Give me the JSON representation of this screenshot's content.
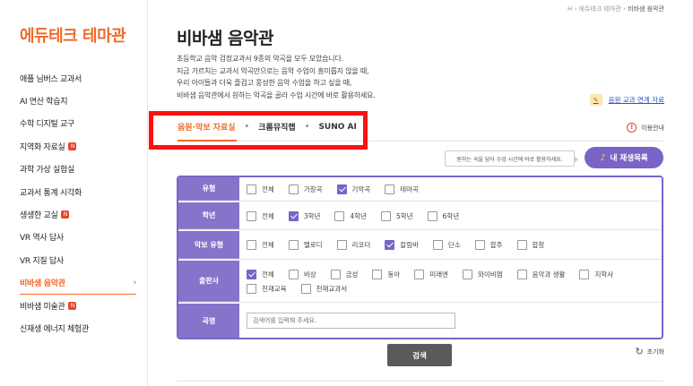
{
  "sidebar": {
    "brand": "에듀테크 테마관",
    "items": [
      {
        "label": "애플 님버스 교과서",
        "new": false
      },
      {
        "label": "AI 연산 학습지",
        "new": false
      },
      {
        "label": "수학 디지털 교구",
        "new": false
      },
      {
        "label": "지역화 자료실",
        "new": true
      },
      {
        "label": "과학 가상 실험실",
        "new": false
      },
      {
        "label": "교과서 통계 시각화",
        "new": false
      },
      {
        "label": "생생한 교실",
        "new": true
      },
      {
        "label": "VR 역사 답사",
        "new": false
      },
      {
        "label": "VR 지질 답사",
        "new": false
      },
      {
        "label": "비바샘 음악관",
        "new": false,
        "active": true
      },
      {
        "label": "비바샘 미술관",
        "new": true
      },
      {
        "label": "신재생 에너지 체험관",
        "new": false
      }
    ],
    "new_badge": "N",
    "active_chevron": "›"
  },
  "breadcrumb": {
    "home": "H",
    "sep1": "›",
    "parent": "에듀테크 테마관",
    "sep2": "›",
    "current": "비바샘 음악관"
  },
  "header": {
    "title": "비바샘 음악관",
    "intro_lines": [
      "초등학교 음악 검정교과서 9종의 악곡을 모두 모았습니다.",
      "지금 가르치는 교과서 악곡만으로는 음악 수업이 흥미롭지 않을 때,",
      "우리 아이들과 더욱 즐겁고 풍성한 음악 수업을 하고 싶을 때,",
      "비바샘 음악관에서 원하는 악곡을 골라 수업 시간에 바로 활용하세요."
    ],
    "linked_label": "음원 교과 연계 자료"
  },
  "tabs": [
    {
      "label": "음원·악보 자료실",
      "active": true
    },
    {
      "label": "크롬뮤직랩",
      "active": false
    },
    {
      "label": "SUNO AI",
      "active": false
    }
  ],
  "tab_sep": "•",
  "usage_label": "이용안내",
  "usage_icon": "!",
  "tip": "원하는 곡을 담아 수업 시간에 바로 활용하세요.",
  "my_list": "내 재생목록",
  "filters": {
    "type": {
      "label": "유형",
      "options": [
        {
          "t": "전체",
          "on": false
        },
        {
          "t": "가창곡",
          "on": false
        },
        {
          "t": "기악곡",
          "on": true
        },
        {
          "t": "테마곡",
          "on": false
        }
      ]
    },
    "grade": {
      "label": "학년",
      "options": [
        {
          "t": "전체",
          "on": false
        },
        {
          "t": "3학년",
          "on": true
        },
        {
          "t": "4학년",
          "on": false
        },
        {
          "t": "5학년",
          "on": false
        },
        {
          "t": "6학년",
          "on": false
        }
      ]
    },
    "score": {
      "label": "악보 유형",
      "options": [
        {
          "t": "전체",
          "on": false
        },
        {
          "t": "멜로디",
          "on": false
        },
        {
          "t": "리코더",
          "on": false
        },
        {
          "t": "칼림바",
          "on": true
        },
        {
          "t": "단소",
          "on": false
        },
        {
          "t": "합주",
          "on": false
        },
        {
          "t": "합창",
          "on": false
        }
      ]
    },
    "publisher": {
      "label": "출판사",
      "options": [
        {
          "t": "전체",
          "on": true
        },
        {
          "t": "비상",
          "on": false
        },
        {
          "t": "금성",
          "on": false
        },
        {
          "t": "동아",
          "on": false
        },
        {
          "t": "미래엔",
          "on": false
        },
        {
          "t": "와이비엠",
          "on": false
        },
        {
          "t": "음악과 생활",
          "on": false
        },
        {
          "t": "지학사",
          "on": false
        },
        {
          "t": "천재교육",
          "on": false
        },
        {
          "t": "천재교과서",
          "on": false
        }
      ]
    },
    "title": {
      "label": "곡명",
      "placeholder": "검색어를 입력해 주세요."
    }
  },
  "search_button": "검색",
  "reset_label": "초기화",
  "reset_icon": "↻",
  "colors": {
    "accent": "#ef6a2b",
    "purple": "#7a64c8",
    "highlight": "#ff1010"
  }
}
